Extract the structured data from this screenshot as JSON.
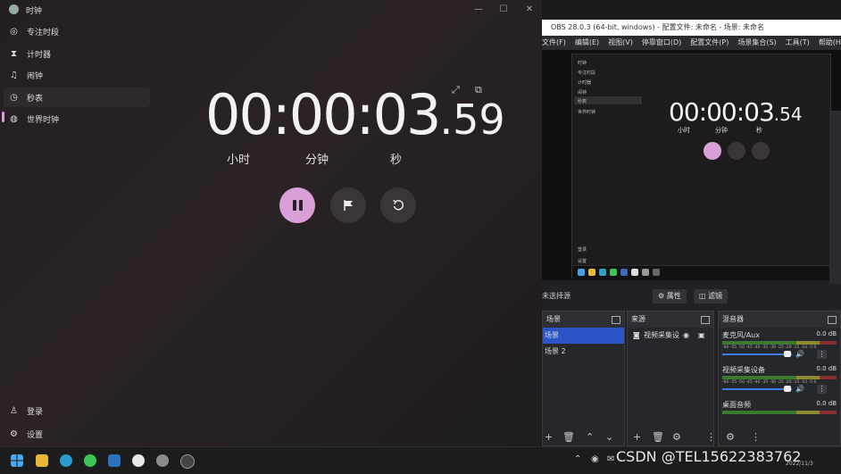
{
  "clock": {
    "title": "时钟",
    "nav": [
      {
        "label": "专注时段",
        "icon": "focus-icon"
      },
      {
        "label": "计时器",
        "icon": "hourglass-icon"
      },
      {
        "label": "闹钟",
        "icon": "bell-icon"
      },
      {
        "label": "秒表",
        "icon": "stopwatch-icon"
      },
      {
        "label": "世界时钟",
        "icon": "globe-icon"
      }
    ],
    "bottom_nav": [
      {
        "label": "登录",
        "icon": "person-icon"
      },
      {
        "label": "设置",
        "icon": "gear-icon"
      }
    ],
    "time_main": "00:00:03",
    "time_ms": ".59",
    "units": [
      "小时",
      "分钟",
      "秒"
    ]
  },
  "obs": {
    "title": "OBS 28.0.3 (64-bit, windows) - 配置文件: 未命名 - 场景: 未命名",
    "menu": [
      "文件(F)",
      "编辑(E)",
      "视图(V)",
      "停靠窗口(D)",
      "配置文件(P)",
      "场景集合(S)",
      "工具(T)",
      "帮助(H)"
    ],
    "preview": {
      "nav": [
        "时钟",
        "专注时段",
        "计时器",
        "闹钟",
        "秒表",
        "世界时钟"
      ],
      "bottom_nav": [
        "登录",
        "设置"
      ],
      "time_main": "00:00:03",
      "time_ms": ".54",
      "units": [
        "小时",
        "分钟",
        "秒"
      ]
    },
    "filter_label": "未选择源",
    "properties_label": "属性",
    "filters_label": "滤镜",
    "scenes": {
      "title": "场景",
      "items": [
        "场景",
        "场景 2"
      ]
    },
    "sources": {
      "title": "来源",
      "items": [
        "视频采集设"
      ]
    },
    "mixer": {
      "title": "混音器",
      "scale": "-60 -55 -50 -45 -40 -35 -30 -25 -20 -15 -10 -5 0",
      "channels": [
        {
          "name": "麦克风/Aux",
          "db": "0.0 dB"
        },
        {
          "name": "视频采集设备",
          "db": "0.0 dB"
        },
        {
          "name": "桌面音频",
          "db": "0.0 dB"
        }
      ]
    }
  },
  "taskbar": {
    "watermark": "CSDN @TEL15622383762",
    "date": "2022/11/3"
  },
  "colors": {
    "accent": "#d9a0d8",
    "obs_selection": "#2b55c7"
  }
}
